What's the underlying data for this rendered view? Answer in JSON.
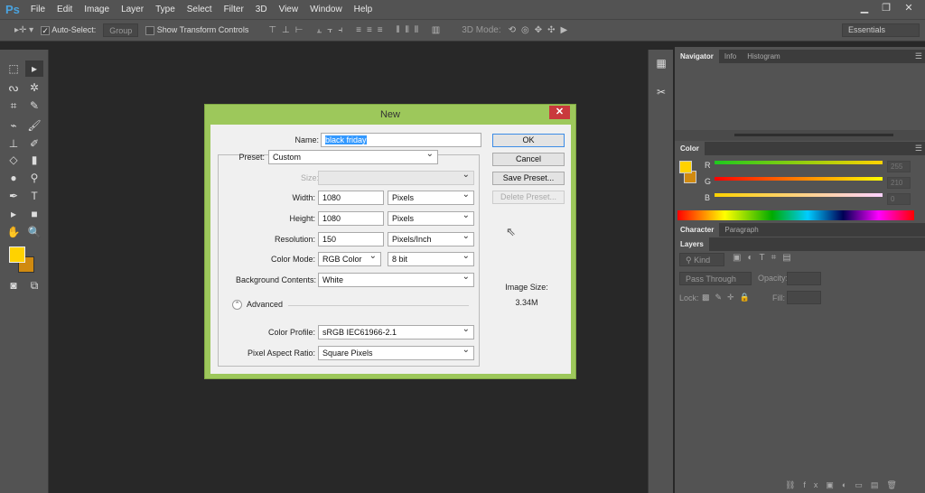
{
  "app": {
    "logo": "Ps",
    "menu": [
      "File",
      "Edit",
      "Image",
      "Layer",
      "Type",
      "Select",
      "Filter",
      "3D",
      "View",
      "Window",
      "Help"
    ]
  },
  "options": {
    "auto_select_label": "Auto-Select:",
    "auto_select_checked": true,
    "group_value": "Group",
    "show_transform_label": "Show Transform Controls",
    "show_transform_checked": false,
    "mode_3d_label": "3D Mode:",
    "workspace": "Essentials"
  },
  "colors": {
    "foreground": "#ffd200",
    "background": "#d08a10",
    "dialog_border": "#9dc85b"
  },
  "panels": {
    "navigator_tabs": [
      "Navigator",
      "Info",
      "Histogram"
    ],
    "color": {
      "tab": "Color",
      "r_label": "R",
      "g_label": "G",
      "b_label": "B",
      "r": "255",
      "g": "210",
      "b": "0"
    },
    "character_tabs": [
      "Character",
      "Paragraph"
    ],
    "layers": {
      "tab": "Layers",
      "kind": "Kind",
      "blend": "Pass Through",
      "opacity_label": "Opacity:",
      "lock_label": "Lock:",
      "fill_label": "Fill:"
    }
  },
  "dialog": {
    "title": "New",
    "name_label": "Name:",
    "name_value": "black friday",
    "preset_label": "Preset:",
    "preset_value": "Custom",
    "size_label": "Size:",
    "width_label": "Width:",
    "width_value": "1080",
    "width_unit": "Pixels",
    "height_label": "Height:",
    "height_value": "1080",
    "height_unit": "Pixels",
    "resolution_label": "Resolution:",
    "resolution_value": "150",
    "resolution_unit": "Pixels/Inch",
    "color_mode_label": "Color Mode:",
    "color_mode_value": "RGB Color",
    "bit_depth": "8 bit",
    "background_label": "Background Contents:",
    "background_value": "White",
    "advanced_label": "Advanced",
    "color_profile_label": "Color Profile:",
    "color_profile_value": "sRGB IEC61966-2.1",
    "pixel_aspect_label": "Pixel Aspect Ratio:",
    "pixel_aspect_value": "Square Pixels",
    "ok": "OK",
    "cancel": "Cancel",
    "save_preset": "Save Preset...",
    "delete_preset": "Delete Preset...",
    "image_size_label": "Image Size:",
    "image_size_value": "3.34M"
  }
}
